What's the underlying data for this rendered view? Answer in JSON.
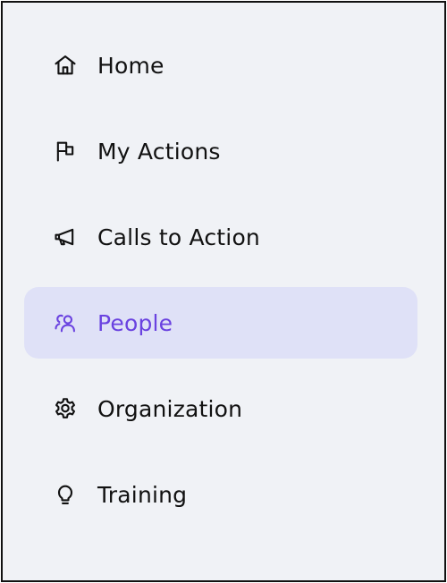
{
  "sidebar": {
    "items": [
      {
        "label": "Home",
        "icon": "home-icon",
        "active": false
      },
      {
        "label": "My Actions",
        "icon": "flag-icon",
        "active": false
      },
      {
        "label": "Calls to Action",
        "icon": "megaphone-icon",
        "active": false
      },
      {
        "label": "People",
        "icon": "people-icon",
        "active": true
      },
      {
        "label": "Organization",
        "icon": "gear-icon",
        "active": false
      },
      {
        "label": "Training",
        "icon": "lightbulb-icon",
        "active": false
      }
    ],
    "colors": {
      "background": "#f0f2f6",
      "active_background": "#dfe1f7",
      "active_text": "#6a42e0",
      "text": "#111111"
    }
  }
}
